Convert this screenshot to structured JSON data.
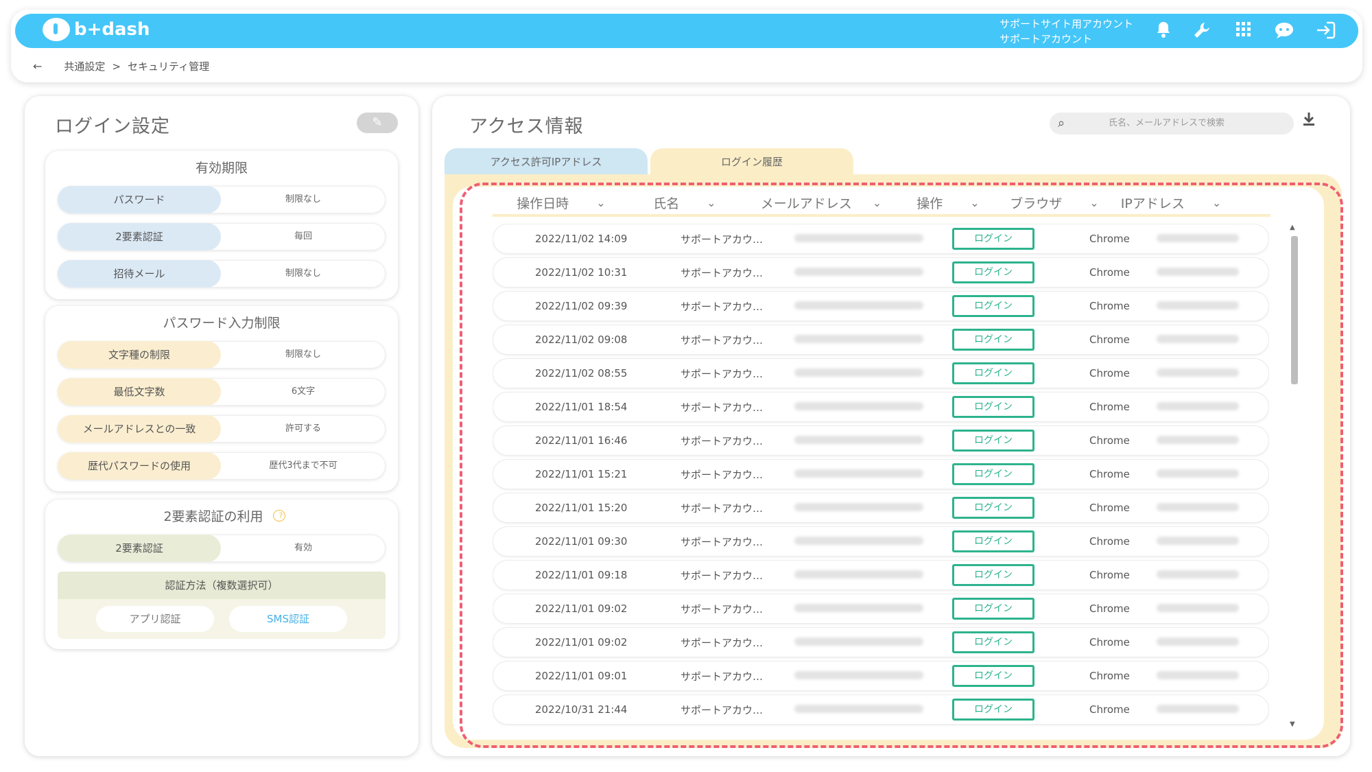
{
  "app": {
    "logo_text": "b+dash",
    "account_line1": "サポートサイト用アカウント",
    "account_line2": "サポートアカウント",
    "icons": [
      "bell-icon",
      "wrench-icon",
      "grid-icon",
      "chat-icon",
      "logout-icon"
    ]
  },
  "breadcrumb": {
    "back": "←",
    "level1": "共通設定",
    "sep": ">",
    "level2": "セキュリティ管理"
  },
  "login_settings": {
    "title": "ログイン設定",
    "expiry": {
      "title": "有効期限",
      "rows": [
        {
          "label": "パスワード",
          "value": "制限なし"
        },
        {
          "label": "2要素認証",
          "value": "毎回"
        },
        {
          "label": "招待メール",
          "value": "制限なし"
        }
      ]
    },
    "password_rules": {
      "title": "パスワード入力制限",
      "rows": [
        {
          "label": "文字種の制限",
          "value": "制限なし"
        },
        {
          "label": "最低文字数",
          "value": "6文字"
        },
        {
          "label": "メールアドレスとの一致",
          "value": "許可する"
        },
        {
          "label": "歴代パスワードの使用",
          "value": "歴代3代まで不可"
        }
      ]
    },
    "two_factor": {
      "title": "2要素認証の利用",
      "help": "?",
      "row": {
        "label": "2要素認証",
        "value": "有効"
      },
      "method_title": "認証方法（複数選択可）",
      "methods": [
        "アプリ認証",
        "SMS認証"
      ],
      "selected_method": "SMS認証"
    }
  },
  "access_info": {
    "title": "アクセス情報",
    "search_placeholder": "氏名、メールアドレスで検索",
    "tabs": [
      "アクセス許可IPアドレス",
      "ログイン履歴"
    ],
    "active_tab": "ログイン履歴",
    "columns": [
      "操作日時",
      "氏名",
      "メールアドレス",
      "操作",
      "ブラウザ",
      "IPアドレス"
    ],
    "rows": [
      {
        "datetime": "2022/11/02 14:09",
        "name": "サポートアカウ…",
        "operation": "ログイン",
        "browser": "Chrome"
      },
      {
        "datetime": "2022/11/02 10:31",
        "name": "サポートアカウ…",
        "operation": "ログイン",
        "browser": "Chrome"
      },
      {
        "datetime": "2022/11/02 09:39",
        "name": "サポートアカウ…",
        "operation": "ログイン",
        "browser": "Chrome"
      },
      {
        "datetime": "2022/11/02 09:08",
        "name": "サポートアカウ…",
        "operation": "ログイン",
        "browser": "Chrome"
      },
      {
        "datetime": "2022/11/02 08:55",
        "name": "サポートアカウ…",
        "operation": "ログイン",
        "browser": "Chrome"
      },
      {
        "datetime": "2022/11/01 18:54",
        "name": "サポートアカウ…",
        "operation": "ログイン",
        "browser": "Chrome"
      },
      {
        "datetime": "2022/11/01 16:46",
        "name": "サポートアカウ…",
        "operation": "ログイン",
        "browser": "Chrome"
      },
      {
        "datetime": "2022/11/01 15:21",
        "name": "サポートアカウ…",
        "operation": "ログイン",
        "browser": "Chrome"
      },
      {
        "datetime": "2022/11/01 15:20",
        "name": "サポートアカウ…",
        "operation": "ログイン",
        "browser": "Chrome"
      },
      {
        "datetime": "2022/11/01 09:30",
        "name": "サポートアカウ…",
        "operation": "ログイン",
        "browser": "Chrome"
      },
      {
        "datetime": "2022/11/01 09:18",
        "name": "サポートアカウ…",
        "operation": "ログイン",
        "browser": "Chrome"
      },
      {
        "datetime": "2022/11/01 09:02",
        "name": "サポートアカウ…",
        "operation": "ログイン",
        "browser": "Chrome"
      },
      {
        "datetime": "2022/11/01 09:02",
        "name": "サポートアカウ…",
        "operation": "ログイン",
        "browser": "Chrome"
      },
      {
        "datetime": "2022/11/01 09:01",
        "name": "サポートアカウ…",
        "operation": "ログイン",
        "browser": "Chrome"
      },
      {
        "datetime": "2022/10/31 21:44",
        "name": "サポートアカウ…",
        "operation": "ログイン",
        "browser": "Chrome"
      }
    ]
  },
  "colors": {
    "header": "#45c6f8",
    "highlight_dashed": "#ee5f73",
    "operation_green": "#2db38d",
    "tab_yellow": "#fbeec7",
    "tab_blue": "#cfe6f3"
  }
}
